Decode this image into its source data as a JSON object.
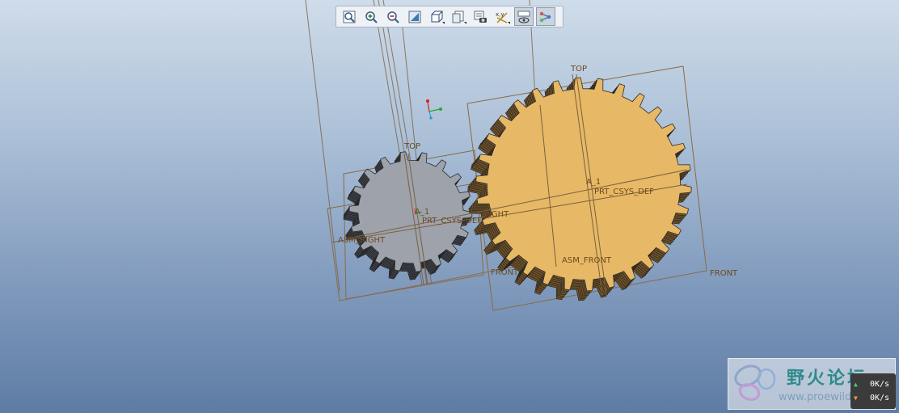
{
  "toolbar": {
    "buttons": [
      {
        "name": "refit-icon",
        "active": false
      },
      {
        "name": "zoom-in-icon",
        "active": false
      },
      {
        "name": "zoom-out-icon",
        "active": false
      },
      {
        "name": "repaint-icon",
        "active": false
      },
      {
        "name": "saved-orientations-icon",
        "active": false
      },
      {
        "name": "display-style-icon",
        "active": false
      },
      {
        "name": "view-manager-icon",
        "active": false
      },
      {
        "name": "datum-display-icon",
        "active": false
      },
      {
        "name": "spin-center-icon",
        "active": true
      },
      {
        "name": "annotation-display-icon",
        "active": true
      }
    ]
  },
  "datums": {
    "top_small": "TOP",
    "top_large": "TOP",
    "asm_right": "ASM_RIGHT",
    "right": "RIGHT",
    "prt_csys_def_small": "PRT_CSYS_DEF",
    "prt_csys_def_large": "PRT_CSYS_DEF",
    "front_small": "FRONT",
    "asm_front": "ASM_FRONT",
    "front_large": "FRONT",
    "axis_a1_small": "A_1",
    "axis_a1_large": "A_1"
  },
  "watermark": {
    "title": "野火论坛",
    "url": "www.proewildfire.cn"
  },
  "net_speed": {
    "upload": "0K/s",
    "download": "0K/s"
  },
  "colors": {
    "small_gear": "#9ea2ab",
    "small_gear_side": "#3f424a",
    "large_gear": "#e7b865",
    "large_gear_side": "#6e5128",
    "datum": "#8a6a46",
    "background_top": "#cfdcea",
    "background_bottom": "#5e7ca4"
  }
}
